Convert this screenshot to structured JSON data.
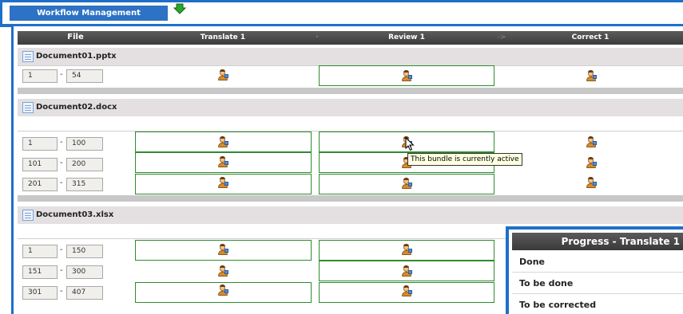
{
  "tab": {
    "label": "Workflow Management"
  },
  "columns": {
    "file": "File",
    "translate": "Translate 1",
    "review": "Review 1",
    "correct": "Correct 1",
    "arrow": "->"
  },
  "documents": [
    {
      "name": "Document01.pptx",
      "ranges": [
        {
          "from": "1",
          "to": "54"
        }
      ]
    },
    {
      "name": "Document02.docx",
      "ranges": [
        {
          "from": "1",
          "to": "100"
        },
        {
          "from": "101",
          "to": "200"
        },
        {
          "from": "201",
          "to": "315"
        }
      ]
    },
    {
      "name": "Document03.xlsx",
      "ranges": [
        {
          "from": "1",
          "to": "150"
        },
        {
          "from": "151",
          "to": "300"
        },
        {
          "from": "301",
          "to": "407"
        }
      ]
    }
  ],
  "tooltip": "This bundle is currently active",
  "progress": {
    "title": "Progress - Translate 1",
    "rows": [
      "Done",
      "To be done",
      "To be corrected"
    ]
  },
  "colors": {
    "accent": "#1f6fc9",
    "cell_border": "#2e8b2e",
    "header_bg": "#4a4a4a",
    "doc_row_bg": "#e4e0e2"
  },
  "icons": {
    "status": "arrow-down-icon",
    "doc": "document-icon",
    "bundle": "user-bundle-icon"
  }
}
